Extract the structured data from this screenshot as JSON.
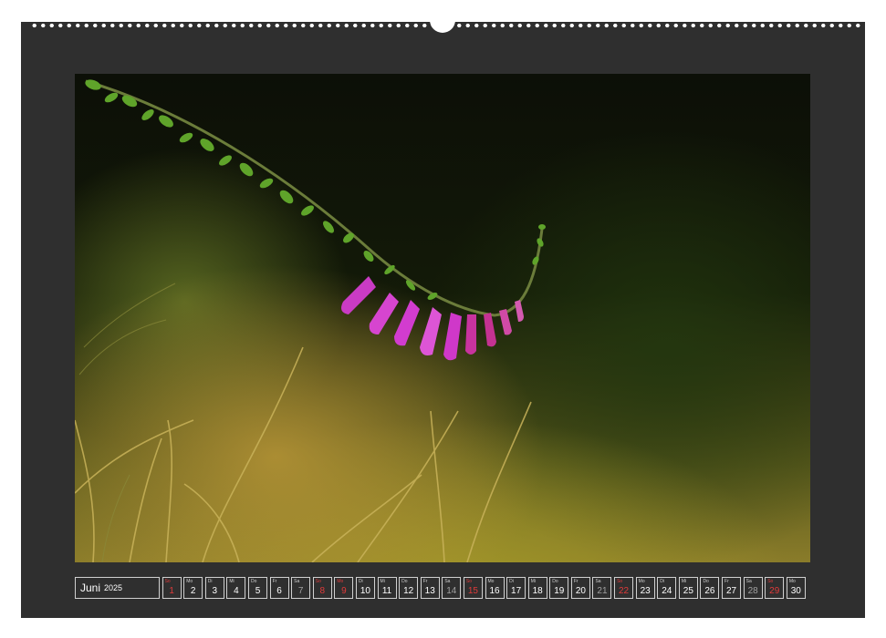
{
  "calendar": {
    "month": "Juni",
    "year": "2025",
    "days": [
      {
        "wd": "So",
        "num": "1",
        "type": "sunday"
      },
      {
        "wd": "Mo",
        "num": "2",
        "type": "weekday"
      },
      {
        "wd": "Di",
        "num": "3",
        "type": "weekday"
      },
      {
        "wd": "Mi",
        "num": "4",
        "type": "weekday"
      },
      {
        "wd": "Do",
        "num": "5",
        "type": "weekday"
      },
      {
        "wd": "Fr",
        "num": "6",
        "type": "weekday"
      },
      {
        "wd": "Sa",
        "num": "7",
        "type": "weekend"
      },
      {
        "wd": "So",
        "num": "8",
        "type": "sunday"
      },
      {
        "wd": "Mo",
        "num": "9",
        "type": "sunday"
      },
      {
        "wd": "Di",
        "num": "10",
        "type": "weekday"
      },
      {
        "wd": "Mi",
        "num": "11",
        "type": "weekday"
      },
      {
        "wd": "Do",
        "num": "12",
        "type": "weekday"
      },
      {
        "wd": "Fr",
        "num": "13",
        "type": "weekday"
      },
      {
        "wd": "Sa",
        "num": "14",
        "type": "weekend"
      },
      {
        "wd": "So",
        "num": "15",
        "type": "sunday"
      },
      {
        "wd": "Mo",
        "num": "16",
        "type": "weekday"
      },
      {
        "wd": "Di",
        "num": "17",
        "type": "weekday"
      },
      {
        "wd": "Mi",
        "num": "18",
        "type": "weekday"
      },
      {
        "wd": "Do",
        "num": "19",
        "type": "weekday"
      },
      {
        "wd": "Fr",
        "num": "20",
        "type": "weekday"
      },
      {
        "wd": "Sa",
        "num": "21",
        "type": "weekend"
      },
      {
        "wd": "So",
        "num": "22",
        "type": "sunday"
      },
      {
        "wd": "Mo",
        "num": "23",
        "type": "weekday"
      },
      {
        "wd": "Di",
        "num": "24",
        "type": "weekday"
      },
      {
        "wd": "Mi",
        "num": "25",
        "type": "weekday"
      },
      {
        "wd": "Do",
        "num": "26",
        "type": "weekday"
      },
      {
        "wd": "Fr",
        "num": "27",
        "type": "weekday"
      },
      {
        "wd": "Sa",
        "num": "28",
        "type": "weekend"
      },
      {
        "wd": "So",
        "num": "29",
        "type": "sunday"
      },
      {
        "wd": "Mo",
        "num": "30",
        "type": "weekday"
      }
    ]
  },
  "photo": {
    "subject": "foxglove-flower",
    "flower_color": "#d23ccf",
    "stem_color": "#5fa42a"
  }
}
